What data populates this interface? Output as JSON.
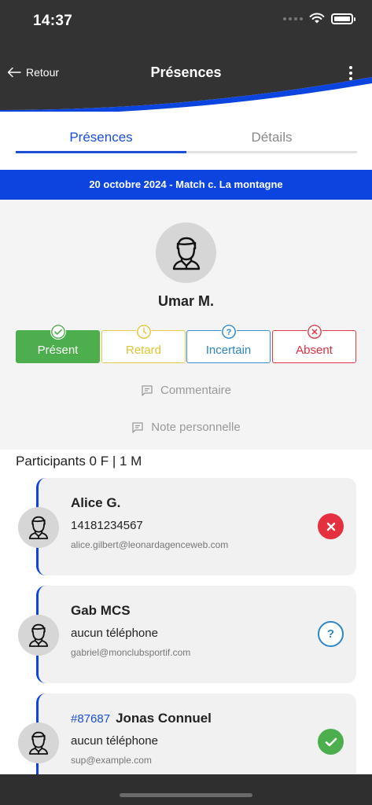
{
  "status_bar": {
    "time": "14:37"
  },
  "nav": {
    "back_label": "Retour",
    "title": "Présences"
  },
  "tabs": [
    {
      "label": "Présences",
      "active": true
    },
    {
      "label": "Détails",
      "active": false
    }
  ],
  "event": {
    "title": "20 octobre 2024 - Match c. La montagne"
  },
  "profile": {
    "name": "Umar M.",
    "status_buttons": [
      {
        "label": "Présent",
        "selected": true,
        "color": "#4cae4c"
      },
      {
        "label": "Retard",
        "selected": false,
        "color": "#e6c84a"
      },
      {
        "label": "Incertain",
        "selected": false,
        "color": "#2f86c6"
      },
      {
        "label": "Absent",
        "selected": false,
        "color": "#dc3a46"
      }
    ],
    "comment_label": "Commentaire",
    "note_label": "Note personnelle"
  },
  "participants": {
    "title": "Participants 0 F | 1 M",
    "items": [
      {
        "tag": "",
        "name": "Alice G.",
        "phone": "14181234567",
        "email": "alice.gilbert@leonardagenceweb.com",
        "status": "absent"
      },
      {
        "tag": "",
        "name": "Gab MCS",
        "phone": "aucun téléphone",
        "email": "gabriel@monclubsportif.com",
        "status": "incertain"
      },
      {
        "tag": "#87687",
        "name": "Jonas Connuel",
        "phone": "aucun téléphone",
        "email": "sup@example.com",
        "status": "present"
      }
    ]
  },
  "colors": {
    "header": "#333333",
    "accent": "#0c44e0",
    "tab_active": "#1a4fd6"
  }
}
